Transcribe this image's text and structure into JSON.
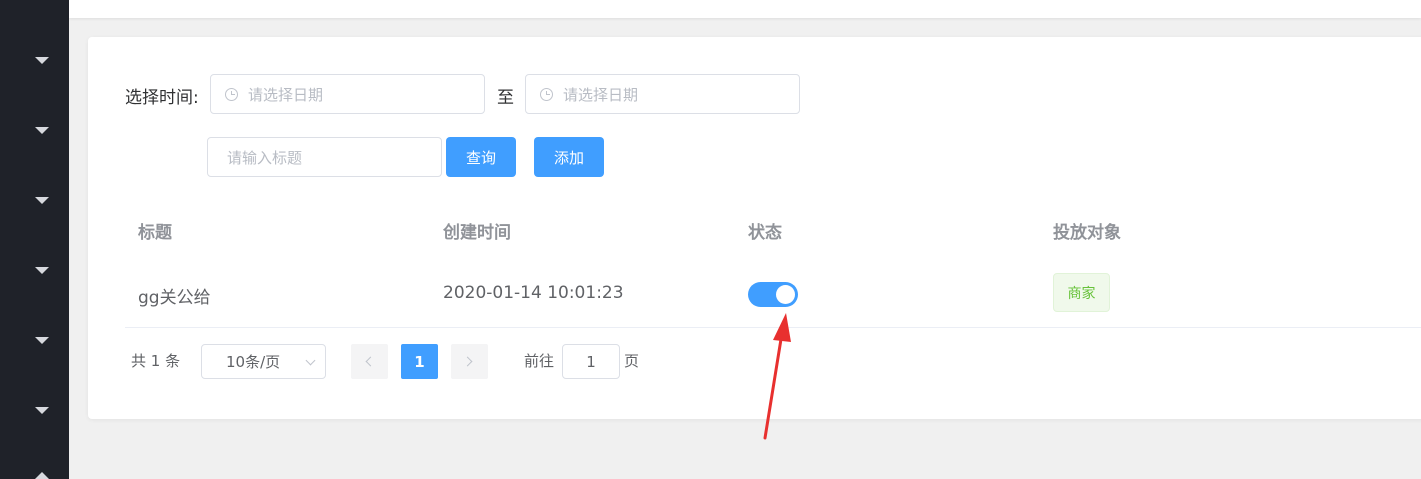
{
  "filters": {
    "time_label": "选择时间:",
    "start_placeholder": "请选择日期",
    "to_label": "至",
    "end_placeholder": "请选择日期",
    "title_placeholder": "请输入标题",
    "search_label": "查询",
    "add_label": "添加"
  },
  "table": {
    "headers": [
      "标题",
      "创建时间",
      "状态",
      "投放对象"
    ],
    "rows": [
      {
        "title": "gg关公给",
        "created": "2020-01-14 10:01:23",
        "status_on": true,
        "target": "商家"
      }
    ]
  },
  "pagination": {
    "total": "共 1 条",
    "page_size": "10条/页",
    "current_page": "1",
    "goto_label": "前往",
    "goto_value": "1",
    "page_unit": "页"
  },
  "colors": {
    "primary": "#409eff",
    "sidebar": "#1f2229",
    "tag_green": "#67c23a",
    "annotation_arrow": "#e8302f"
  },
  "icons": {
    "date_input": "clock-icon",
    "sidebar": "caret-down-icon",
    "prev": "chevron-left-icon",
    "next": "chevron-right-icon",
    "select": "chevron-down-icon"
  }
}
